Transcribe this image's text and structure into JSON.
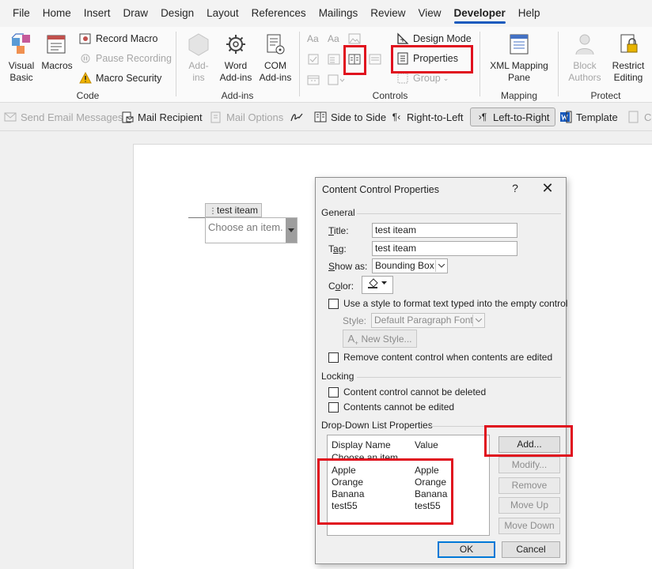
{
  "menu": [
    "File",
    "Home",
    "Insert",
    "Draw",
    "Design",
    "Layout",
    "References",
    "Mailings",
    "Review",
    "View",
    "Developer",
    "Help"
  ],
  "active_menu": "Developer",
  "ribbon": {
    "code": {
      "label": "Code",
      "visual_basic": "Visual\nBasic",
      "macros": "Macros",
      "record_macro": "Record Macro",
      "pause_recording": "Pause Recording",
      "macro_security": "Macro Security"
    },
    "addins": {
      "label": "Add-ins",
      "addins_btn": "Add-\nins",
      "word_addins": "Word\nAdd-ins",
      "com_addins": "COM\nAdd-ins"
    },
    "controls": {
      "label": "Controls",
      "design_mode": "Design Mode",
      "properties": "Properties",
      "group": "Group"
    },
    "mapping": {
      "label": "Mapping",
      "xml_pane": "XML Mapping\nPane"
    },
    "protect": {
      "label": "Protect",
      "block_authors": "Block\nAuthors",
      "restrict_editing": "Restrict\nEditing"
    }
  },
  "quickbar": {
    "send_email": "Send Email Messages",
    "mail_recipient": "Mail Recipient",
    "mail_options": "Mail Options",
    "side_to_side": "Side to Side",
    "right_to_left": "Right-to-Left",
    "left_to_right": "Left-to-Right",
    "template": "Template",
    "cut_off": "Co"
  },
  "document": {
    "control_title": "test iteam",
    "placeholder": "Choose an item."
  },
  "dialog": {
    "title": "Content Control Properties",
    "help": "?",
    "close": "✕",
    "general": "General",
    "title_label": "Title:",
    "title_value": "test iteam",
    "tag_label": "Tag:",
    "tag_value": "test iteam",
    "showas_label": "Show as:",
    "showas_value": "Bounding Box",
    "color_label": "Color:",
    "use_style": "Use a style to format text typed into the empty control",
    "style_label": "Style:",
    "style_value": "Default Paragraph Font",
    "new_style": "New Style...",
    "remove_cc": "Remove content control when contents are edited",
    "locking": "Locking",
    "lock_delete": "Content control cannot be deleted",
    "lock_edit": "Contents cannot be edited",
    "ddl_props": "Drop-Down List Properties",
    "col_display": "Display Name",
    "col_value": "Value",
    "items": [
      {
        "display": "Choose an item.",
        "value": ""
      },
      {
        "display": "Apple",
        "value": "Apple"
      },
      {
        "display": "Orange",
        "value": "Orange"
      },
      {
        "display": "Banana",
        "value": "Banana"
      },
      {
        "display": "test55",
        "value": "test55"
      }
    ],
    "btn_add": "Add...",
    "btn_modify": "Modify...",
    "btn_remove": "Remove",
    "btn_moveup": "Move Up",
    "btn_movedown": "Move Down",
    "btn_ok": "OK",
    "btn_cancel": "Cancel"
  },
  "colors": {
    "highlight": "#e0101e",
    "accent": "#185abd"
  }
}
